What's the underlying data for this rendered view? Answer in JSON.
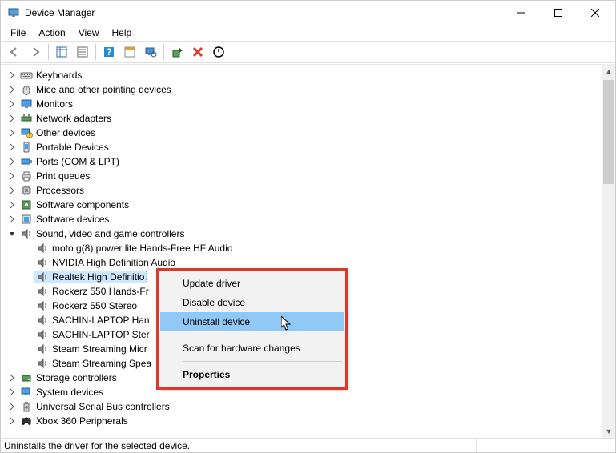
{
  "window": {
    "title": "Device Manager"
  },
  "menubar": [
    "File",
    "Action",
    "View",
    "Help"
  ],
  "tree": [
    {
      "d": 1,
      "ex": "r",
      "icon": "keyboard",
      "label": "Keyboards"
    },
    {
      "d": 1,
      "ex": "r",
      "icon": "mouse",
      "label": "Mice and other pointing devices"
    },
    {
      "d": 1,
      "ex": "r",
      "icon": "monitor",
      "label": "Monitors"
    },
    {
      "d": 1,
      "ex": "r",
      "icon": "net",
      "label": "Network adapters"
    },
    {
      "d": 1,
      "ex": "r",
      "icon": "other",
      "label": "Other devices"
    },
    {
      "d": 1,
      "ex": "r",
      "icon": "portable",
      "label": "Portable Devices"
    },
    {
      "d": 1,
      "ex": "r",
      "icon": "port",
      "label": "Ports (COM & LPT)"
    },
    {
      "d": 1,
      "ex": "r",
      "icon": "printq",
      "label": "Print queues"
    },
    {
      "d": 1,
      "ex": "r",
      "icon": "cpu",
      "label": "Processors"
    },
    {
      "d": 1,
      "ex": "r",
      "icon": "swc",
      "label": "Software components"
    },
    {
      "d": 1,
      "ex": "r",
      "icon": "swd",
      "label": "Software devices"
    },
    {
      "d": 1,
      "ex": "d",
      "icon": "sound",
      "label": "Sound, video and game controllers"
    },
    {
      "d": 2,
      "ex": "",
      "icon": "sound",
      "label": "moto g(8) power lite Hands-Free HF Audio"
    },
    {
      "d": 2,
      "ex": "",
      "icon": "sound",
      "label": "NVIDIA High Definition Audio"
    },
    {
      "d": 2,
      "ex": "",
      "icon": "sound",
      "label": "Realtek High Definitio",
      "sel": true
    },
    {
      "d": 2,
      "ex": "",
      "icon": "sound",
      "label": "Rockerz 550 Hands-Fr"
    },
    {
      "d": 2,
      "ex": "",
      "icon": "sound",
      "label": "Rockerz 550 Stereo"
    },
    {
      "d": 2,
      "ex": "",
      "icon": "sound",
      "label": "SACHIN-LAPTOP Han"
    },
    {
      "d": 2,
      "ex": "",
      "icon": "sound",
      "label": "SACHIN-LAPTOP Ster"
    },
    {
      "d": 2,
      "ex": "",
      "icon": "sound",
      "label": "Steam Streaming Micr"
    },
    {
      "d": 2,
      "ex": "",
      "icon": "sound",
      "label": "Steam Streaming Spea"
    },
    {
      "d": 1,
      "ex": "r",
      "icon": "storage",
      "label": "Storage controllers"
    },
    {
      "d": 1,
      "ex": "r",
      "icon": "system",
      "label": "System devices"
    },
    {
      "d": 1,
      "ex": "r",
      "icon": "usb",
      "label": "Universal Serial Bus controllers"
    },
    {
      "d": 1,
      "ex": "r",
      "icon": "xbox",
      "label": "Xbox 360 Peripherals"
    }
  ],
  "context_menu": {
    "items": [
      {
        "label": "Update driver"
      },
      {
        "label": "Disable device"
      },
      {
        "label": "Uninstall device",
        "hl": true
      },
      {
        "sep": true
      },
      {
        "label": "Scan for hardware changes"
      },
      {
        "sep": true
      },
      {
        "label": "Properties",
        "bold": true
      }
    ]
  },
  "status": {
    "text": "Uninstalls the driver for the selected device."
  }
}
